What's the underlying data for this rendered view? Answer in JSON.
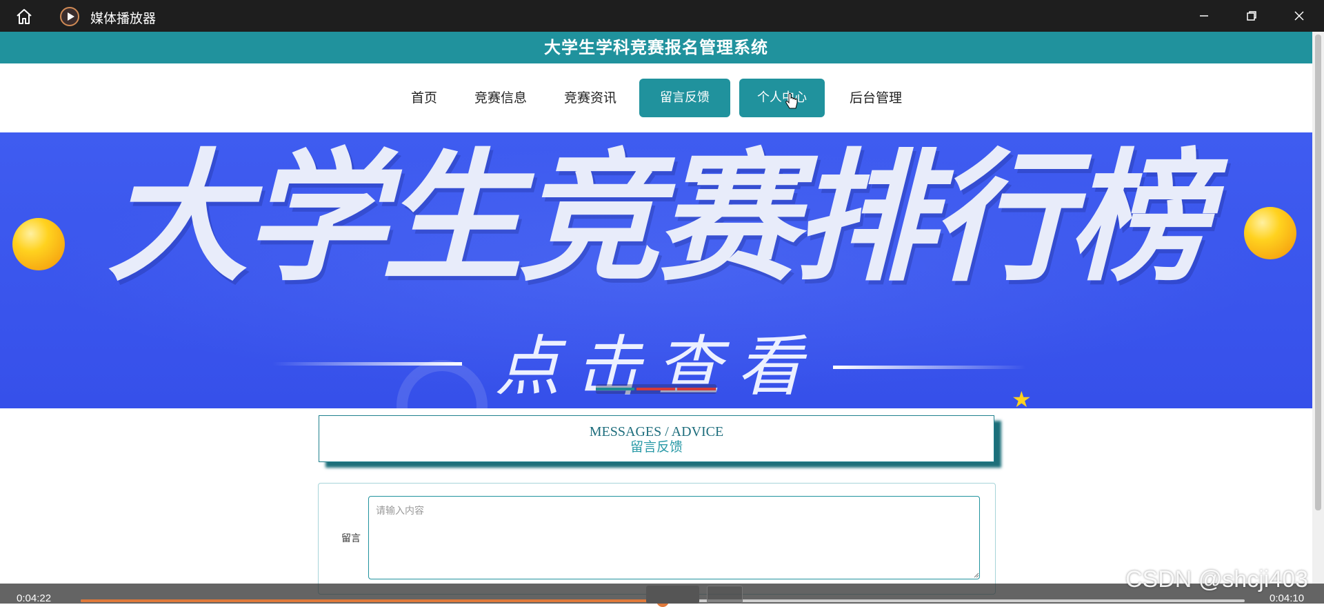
{
  "window": {
    "title": "媒体播放器",
    "icons": {
      "home": "home-icon",
      "app": "media-player-icon",
      "minimize": "minimize-icon",
      "maximize": "restore-icon",
      "close": "close-icon"
    }
  },
  "site": {
    "title": "大学生学科竞赛报名管理系统",
    "accent_color": "#20929d"
  },
  "nav": {
    "items": [
      {
        "label": "首页"
      },
      {
        "label": "竞赛信息"
      },
      {
        "label": "竞赛资讯"
      },
      {
        "label": "留言反馈"
      },
      {
        "label": "个人中心"
      },
      {
        "label": "后台管理"
      }
    ]
  },
  "banner": {
    "title": "大学生竞赛排行榜",
    "subtitle": "点击查看"
  },
  "messages": {
    "heading_en": "MESSAGES / ADVICE",
    "heading_zh": "留言反馈",
    "form": {
      "label": "留言",
      "placeholder": "请输入内容",
      "value": ""
    }
  },
  "player": {
    "elapsed": "0:04:22",
    "remaining": "0:04:10",
    "progress": 0.5,
    "progress_color": "#e0793a"
  },
  "watermark": "CSDN @shcji403"
}
